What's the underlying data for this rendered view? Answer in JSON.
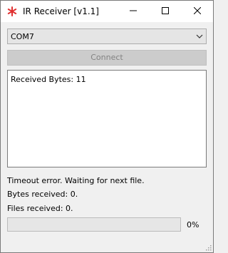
{
  "window": {
    "title": "IR Receiver [v1.1]",
    "accent": "#e03030"
  },
  "port_select": {
    "selected": "COM7"
  },
  "connect_button": {
    "label": "Connect"
  },
  "log": {
    "lines": [
      "Received Bytes: 11"
    ]
  },
  "status": {
    "message": "Timeout error. Waiting for next file.",
    "bytes_received": "Bytes received: 0.",
    "files_received": "Files received: 0."
  },
  "progress": {
    "value": 0,
    "label": "0%"
  },
  "icons": {
    "app": "red-asterisk-icon",
    "minimize": "minimize-icon",
    "maximize": "maximize-icon",
    "close": "close-icon",
    "dropdown": "chevron-down-icon",
    "resize": "resize-grip-icon"
  }
}
